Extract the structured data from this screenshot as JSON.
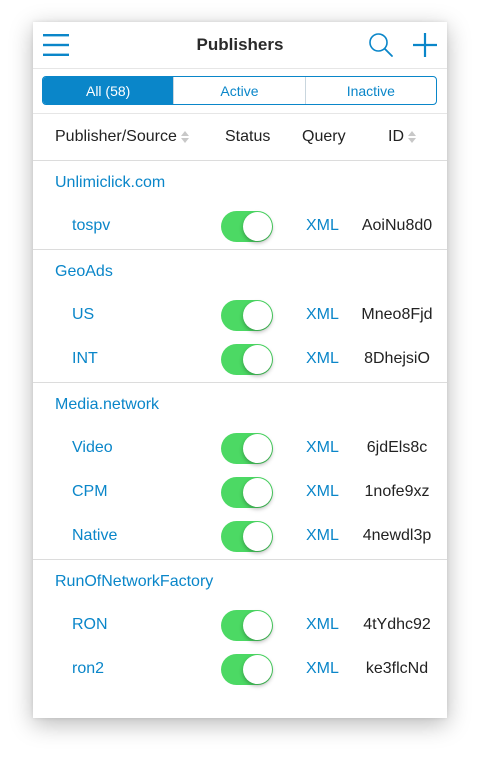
{
  "header": {
    "title": "Publishers"
  },
  "tabs": [
    {
      "label": "All (58)",
      "active": true
    },
    {
      "label": "Active",
      "active": false
    },
    {
      "label": "Inactive",
      "active": false
    }
  ],
  "columns": {
    "publisher": "Publisher/Source",
    "status": "Status",
    "query": "Query",
    "id": "ID"
  },
  "groups": [
    {
      "name": "Unlimiclick.com",
      "rows": [
        {
          "name": "tospv",
          "status": true,
          "query": "XML",
          "id": "AoiNu8d0"
        }
      ]
    },
    {
      "name": "GeoAds",
      "rows": [
        {
          "name": "US",
          "status": true,
          "query": "XML",
          "id": "Mneo8Fjd"
        },
        {
          "name": "INT",
          "status": true,
          "query": "XML",
          "id": "8DhejsiO"
        }
      ]
    },
    {
      "name": "Media.network",
      "rows": [
        {
          "name": "Video",
          "status": true,
          "query": "XML",
          "id": "6jdEls8c"
        },
        {
          "name": "CPM",
          "status": true,
          "query": "XML",
          "id": "1nofe9xz"
        },
        {
          "name": "Native",
          "status": true,
          "query": "XML",
          "id": "4newdl3p"
        }
      ]
    },
    {
      "name": "RunOfNetworkFactory",
      "rows": [
        {
          "name": "RON",
          "status": true,
          "query": "XML",
          "id": "4tYdhc92"
        },
        {
          "name": "ron2",
          "status": true,
          "query": "XML",
          "id": "ke3flcNd"
        }
      ]
    }
  ],
  "colors": {
    "accent": "#0a86c9",
    "toggle_on": "#4cd964"
  },
  "icons": {
    "menu": "hamburger-menu-icon",
    "search": "search-icon",
    "add": "plus-icon",
    "sort": "sort-arrows-icon"
  }
}
